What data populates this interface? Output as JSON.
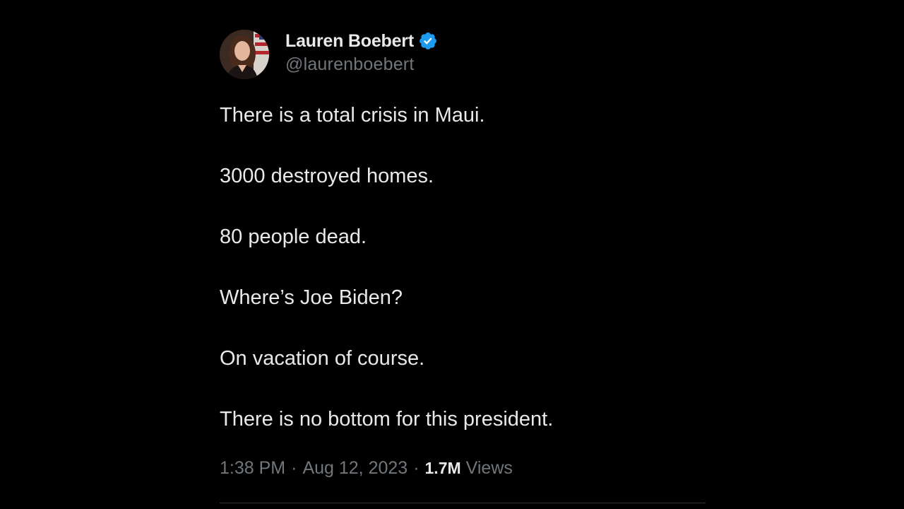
{
  "author": {
    "display_name": "Lauren Boebert",
    "handle": "@laurenboebert",
    "verified": true,
    "verified_color": "#1d9bf0",
    "avatar_icon": "profile-photo"
  },
  "tweet": {
    "lines": [
      "There is a total crisis in Maui.",
      "3000 destroyed homes.",
      "80 people dead.",
      "Where’s Joe Biden?",
      "On vacation of course.",
      "There is no bottom for this president."
    ]
  },
  "meta": {
    "time": "1:38 PM",
    "separator": "·",
    "date": "Aug 12, 2023",
    "views_count": "1.7M",
    "views_label": "Views"
  },
  "colors": {
    "background": "#000000",
    "text_primary": "#e7e9ea",
    "text_secondary": "#71767b",
    "divider": "#2f3336"
  }
}
